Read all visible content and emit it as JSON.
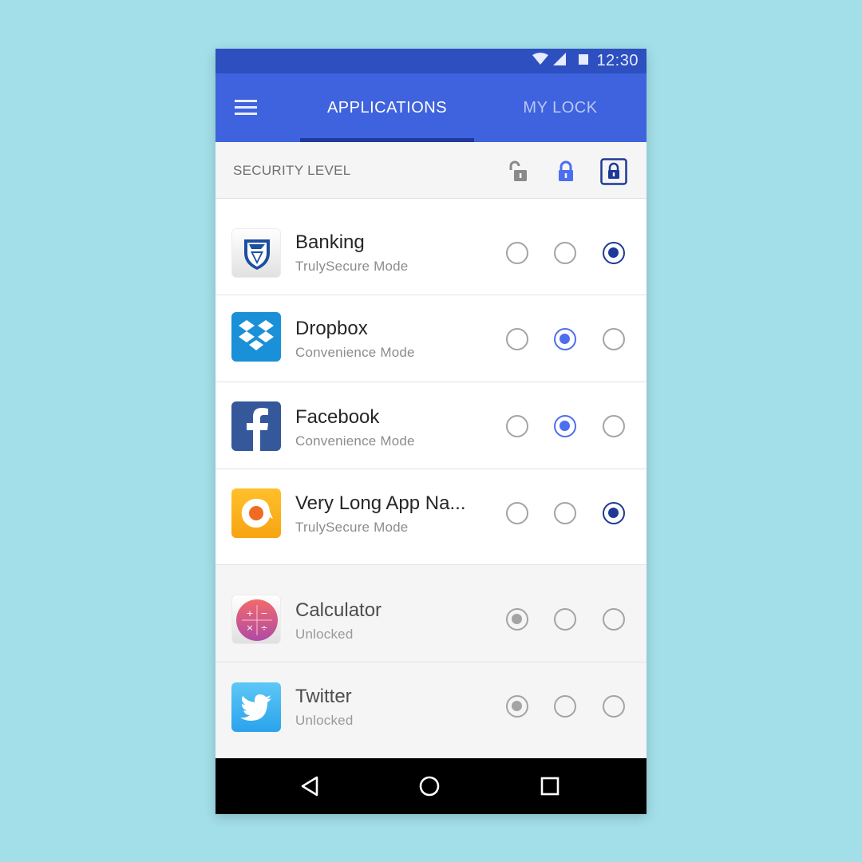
{
  "status_bar": {
    "time": "12:30",
    "icons": [
      "wifi-icon",
      "signal-icon",
      "battery-icon"
    ]
  },
  "app_bar": {
    "menu_icon": "menu-icon",
    "tabs": [
      {
        "label": "APPLICATIONS",
        "active": true
      },
      {
        "label": "MY LOCK",
        "active": false
      }
    ]
  },
  "security_header": {
    "label": "SECURITY LEVEL",
    "level_icons": [
      "unlocked-icon",
      "lock-icon",
      "secure-lock-icon"
    ]
  },
  "apps": [
    {
      "name": "Banking",
      "mode": "TrulySecure Mode",
      "icon": "banking-icon",
      "level": 3,
      "group": "locked"
    },
    {
      "name": "Dropbox",
      "mode": "Convenience Mode",
      "icon": "dropbox-icon",
      "level": 2,
      "group": "locked"
    },
    {
      "name": "Facebook",
      "mode": "Convenience Mode",
      "icon": "facebook-icon",
      "level": 2,
      "group": "locked"
    },
    {
      "name": "Very Long App Na...",
      "mode": "TrulySecure Mode",
      "icon": "orange-chat-icon",
      "level": 3,
      "group": "locked"
    },
    {
      "name": "Calculator",
      "mode": "Unlocked",
      "icon": "calculator-icon",
      "level": 1,
      "group": "unlocked"
    },
    {
      "name": "Twitter",
      "mode": "Unlocked",
      "icon": "twitter-icon",
      "level": 1,
      "group": "unlocked"
    }
  ],
  "colors": {
    "status_bar": "#2d4fbf",
    "app_bar": "#3f63de",
    "tab_indicator": "#1f3a9e",
    "radio_convenience": "#4d6ef0",
    "radio_secure": "#1e3a96",
    "radio_unlocked": "#a4a4a4",
    "background": "#a3dfe9"
  },
  "nav_bar": {
    "buttons": [
      "back-icon",
      "home-icon",
      "recents-icon"
    ]
  }
}
